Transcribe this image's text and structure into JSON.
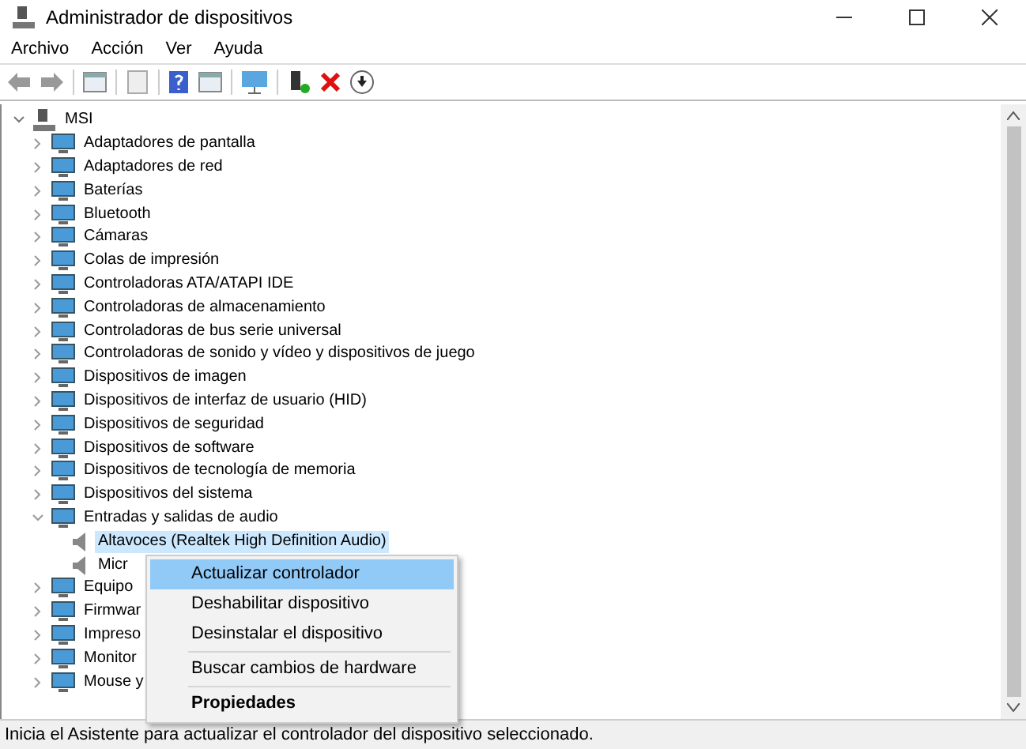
{
  "window": {
    "title": "Administrador de dispositivos"
  },
  "menu": [
    "Archivo",
    "Acción",
    "Ver",
    "Ayuda"
  ],
  "tree": {
    "label": "MSI",
    "expanded": true,
    "children": [
      {
        "label": "Adaptadores de pantalla",
        "expanded": false,
        "selected": false
      },
      {
        "label": "Adaptadores de red",
        "expanded": false,
        "selected": false
      },
      {
        "label": "Baterías",
        "expanded": false,
        "selected": false
      },
      {
        "label": "Bluetooth",
        "expanded": false,
        "selected": false
      },
      {
        "label": "Cámaras",
        "expanded": false,
        "selected": false
      },
      {
        "label": "Colas de impresión",
        "expanded": false,
        "selected": false
      },
      {
        "label": "Controladoras ATA/ATAPI IDE",
        "expanded": false,
        "selected": false
      },
      {
        "label": "Controladoras de almacenamiento",
        "expanded": false,
        "selected": false
      },
      {
        "label": "Controladoras de bus serie universal",
        "expanded": false,
        "selected": false
      },
      {
        "label": "Controladoras de sonido y vídeo y dispositivos de juego",
        "expanded": false,
        "selected": false
      },
      {
        "label": "Dispositivos de imagen",
        "expanded": false,
        "selected": false
      },
      {
        "label": "Dispositivos de interfaz de usuario (HID)",
        "expanded": false,
        "selected": false
      },
      {
        "label": "Dispositivos de seguridad",
        "expanded": false,
        "selected": false
      },
      {
        "label": "Dispositivos de software",
        "expanded": false,
        "selected": false
      },
      {
        "label": "Dispositivos de tecnología de memoria",
        "expanded": false,
        "selected": false
      },
      {
        "label": "Dispositivos del sistema",
        "expanded": false,
        "selected": false
      },
      {
        "label": "Entradas y salidas de audio",
        "expanded": true,
        "selected": false,
        "children": [
          {
            "label": "Altavoces (Realtek High Definition Audio)",
            "selected": true
          },
          {
            "label": "Micr",
            "selected": false
          }
        ]
      },
      {
        "label": "Equipo",
        "expanded": false,
        "selected": false
      },
      {
        "label": "Firmwar",
        "expanded": false,
        "selected": false
      },
      {
        "label": "Impreso",
        "expanded": false,
        "selected": false
      },
      {
        "label": "Monitor",
        "expanded": false,
        "selected": false
      },
      {
        "label": "Mouse y",
        "expanded": false,
        "selected": false
      }
    ]
  },
  "context_menu": [
    {
      "kind": "item",
      "label": "Actualizar controlador",
      "selected": true
    },
    {
      "kind": "item",
      "label": "Deshabilitar dispositivo",
      "selected": false
    },
    {
      "kind": "item",
      "label": "Desinstalar el dispositivo",
      "selected": false
    },
    {
      "kind": "separator"
    },
    {
      "kind": "item",
      "label": "Buscar cambios de hardware",
      "selected": false
    },
    {
      "kind": "separator"
    },
    {
      "kind": "default",
      "label": "Propiedades",
      "selected": false
    }
  ],
  "status_bar": "Inicia el Asistente para actualizar el controlador del dispositivo seleccionado."
}
